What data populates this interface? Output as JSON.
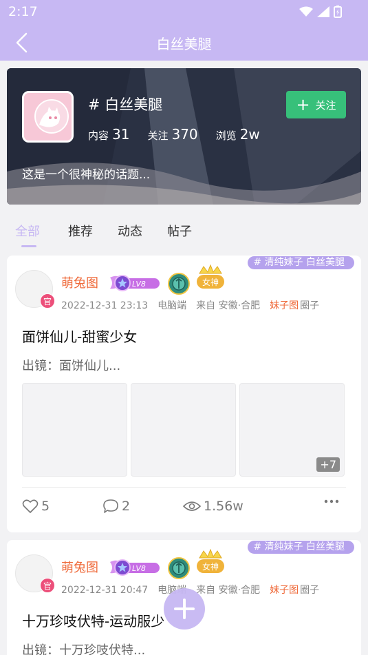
{
  "status_bar": {
    "time": "2:17"
  },
  "nav": {
    "title": "白丝美腿"
  },
  "topic": {
    "name": "# 白丝美腿",
    "stats": [
      {
        "label": "内容",
        "value": "31"
      },
      {
        "label": "关注",
        "value": "370"
      },
      {
        "label": "浏览",
        "value": "2w"
      }
    ],
    "description": "这是一个很神秘的话题...",
    "follow_label": "关注"
  },
  "tabs": [
    {
      "label": "全部",
      "active": true
    },
    {
      "label": "推荐",
      "active": false
    },
    {
      "label": "动态",
      "active": false
    },
    {
      "label": "帖子",
      "active": false
    }
  ],
  "posts": [
    {
      "tags": "# 清纯妹子  白丝美腿",
      "author": "萌兔图",
      "official_badge": "官",
      "level": "LV8",
      "time": "2022-12-31 23:13",
      "device": "电脑端",
      "location": "来自 安徽·合肥",
      "circle": "妹子图",
      "circle_suffix": "圈子",
      "title": "面饼仙儿-甜蜜少女",
      "desc": "出镜：面饼仙儿...",
      "more_images": "+7",
      "likes": "5",
      "comments": "2",
      "views": "1.56w"
    },
    {
      "tags": "# 清纯妹子  白丝美腿",
      "author": "萌兔图",
      "official_badge": "官",
      "level": "LV8",
      "time": "2022-12-31 20:47",
      "device": "电脑端",
      "location": "来自 安徽·合肥",
      "circle": "妹子图",
      "circle_suffix": "圈子",
      "title": "十万珍吱伏特-运动服少",
      "desc": "出镜：十万珍吱伏特..."
    }
  ],
  "colors": {
    "accent": "#c7b8f3",
    "follow": "#37c07a",
    "author": "#ef6a3a",
    "official": "#ec4f7a"
  }
}
